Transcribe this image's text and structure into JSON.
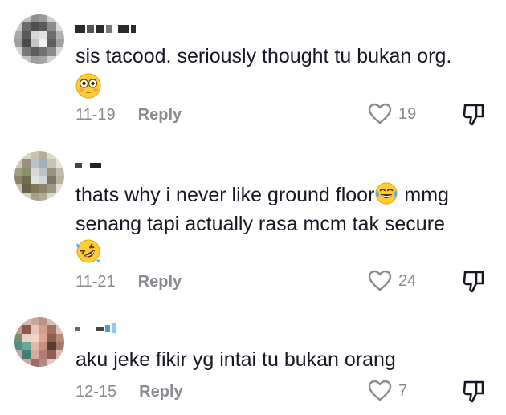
{
  "comments": [
    {
      "text": "sis tacood. seriously thought tu bukan org.",
      "emoji": "flushed-face",
      "date": "11-19",
      "reply_label": "Reply",
      "likes": "19"
    },
    {
      "text_before_emoji": "thats why i never like ground floor",
      "inline_emoji": "face-with-tears-of-joy",
      "text_after_emoji": " mmg\nsenang tapi actually rasa mcm tak secure",
      "emoji": "rolling-on-floor-laughing",
      "date": "11-21",
      "reply_label": "Reply",
      "likes": "24"
    },
    {
      "text": "aku jeke fikir yg intai tu bukan orang",
      "date": "12-15",
      "reply_label": "Reply",
      "likes": "7"
    }
  ],
  "colors": {
    "text": "#161823",
    "secondary": "#8a8b91"
  }
}
